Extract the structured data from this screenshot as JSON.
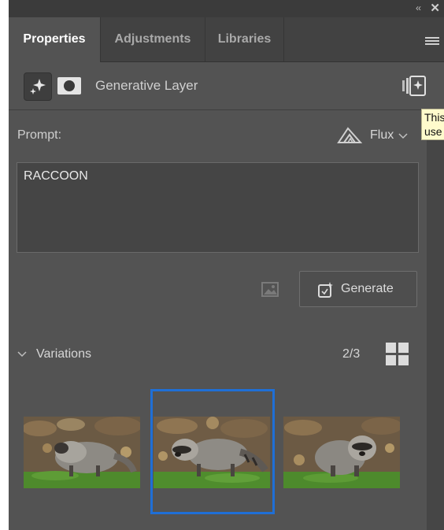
{
  "window": {
    "collapse_glyph": "‹‹",
    "close_glyph": "✕"
  },
  "tabs": [
    {
      "label": "Properties",
      "active": true
    },
    {
      "label": "Adjustments",
      "active": false
    },
    {
      "label": "Libraries",
      "active": false
    }
  ],
  "layer": {
    "name": "Generative Layer"
  },
  "tooltip": {
    "text": "This use"
  },
  "prompt": {
    "label": "Prompt:",
    "model": "Flux",
    "value": "RACCOON"
  },
  "actions": {
    "generate_label": "Generate"
  },
  "variations": {
    "label": "Variations",
    "counter": "2/3",
    "selected_index": 1,
    "thumbnails": [
      {
        "name": "raccoon-variation-1"
      },
      {
        "name": "raccoon-variation-2"
      },
      {
        "name": "raccoon-variation-3"
      }
    ]
  },
  "colors": {
    "selection": "#1f6fd6",
    "panel": "#535353",
    "tooltip_bg": "#fffbcc"
  }
}
